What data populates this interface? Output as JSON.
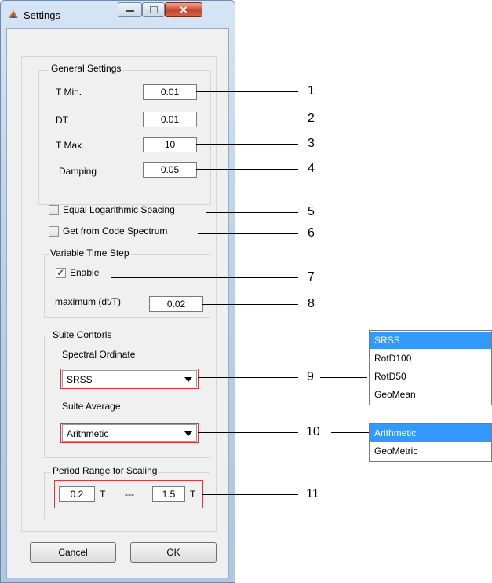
{
  "window": {
    "title": "Settings"
  },
  "general": {
    "title": "General Settings",
    "tmin_label": "T Min.",
    "tmin_value": "0.01",
    "dt_label": "DT",
    "dt_value": "0.01",
    "tmax_label": "T Max.",
    "tmax_value": "10",
    "damping_label": "Damping",
    "damping_value": "0.05"
  },
  "options": {
    "equal_log_label": "Equal Logarithmic Spacing",
    "equal_log_checked": false,
    "code_spectrum_label": "Get from Code Spectrum",
    "code_spectrum_checked": false
  },
  "variable": {
    "title": "Variable Time Step",
    "enable_label": "Enable",
    "enable_checked": true,
    "max_label": "maximum (dt/T)",
    "max_value": "0.02"
  },
  "suite": {
    "title": "Suite Contorls",
    "ordinate_label": "Spectral Ordinate",
    "ordinate_value": "SRSS",
    "average_label": "Suite Average",
    "average_value": "Arithmetic"
  },
  "period": {
    "title": "Period Range for Scaling",
    "min_value": "0.2",
    "unit1": "T",
    "separator": "---",
    "max_value": "1.5",
    "unit2": "T"
  },
  "buttons": {
    "cancel": "Cancel",
    "ok": "OK"
  },
  "callouts": [
    "1",
    "2",
    "3",
    "4",
    "5",
    "6",
    "7",
    "8",
    "9",
    "10",
    "11"
  ],
  "ordinate_options": [
    "SRSS",
    "RotD100",
    "RotD50",
    "GeoMean"
  ],
  "average_options": [
    "Arithmetic",
    "GeoMetric"
  ]
}
